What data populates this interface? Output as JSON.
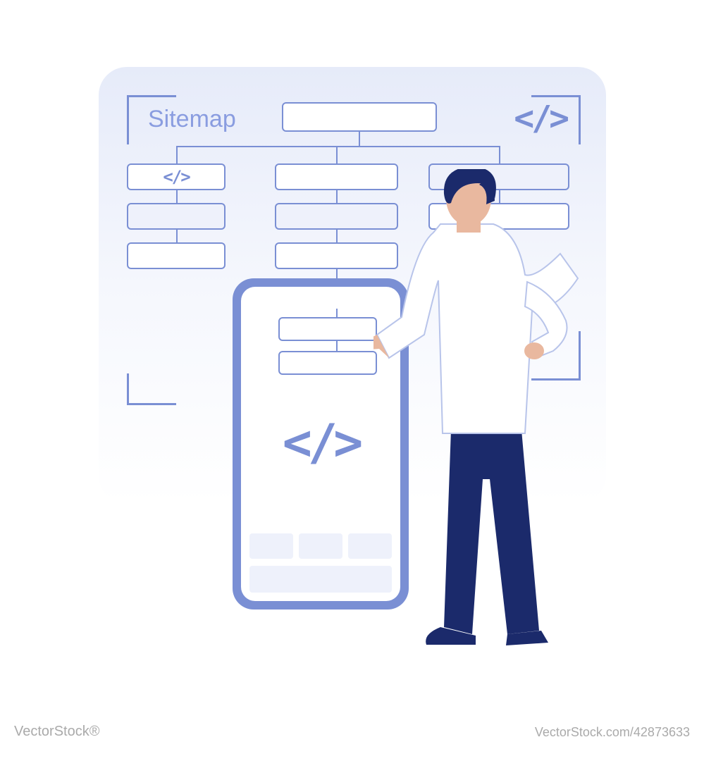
{
  "sitemap": {
    "label": "Sitemap",
    "code_symbol": "</>"
  },
  "phone": {
    "code_symbol": "</>"
  },
  "watermark": {
    "left": "VectorStock®",
    "right": "VectorStock.com/42873633"
  },
  "colors": {
    "primary": "#7a8fd4",
    "navy": "#1b2a6b",
    "light": "#eef1fb"
  }
}
